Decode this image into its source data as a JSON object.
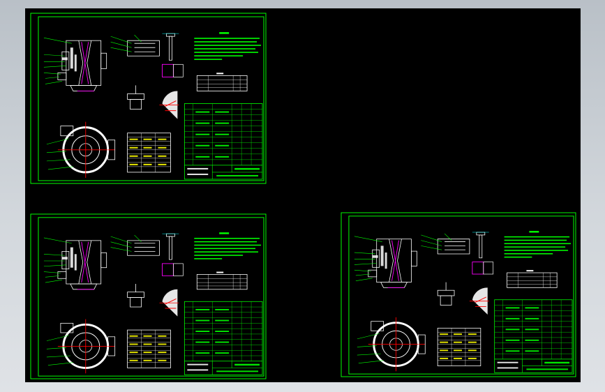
{
  "colors": {
    "background": "#c9cfd5",
    "viewport": "#000000",
    "sheet_frame": "#00ff00",
    "line": "#00ff00",
    "text": "#ffffff",
    "table_text": "#ffff00",
    "dimension": "#00ffff",
    "highlight": "#ff00ff",
    "part": "#ffffff"
  },
  "sheets": [
    {
      "id": "sheet-1",
      "style": "green"
    },
    {
      "id": "sheet-2",
      "style": "green"
    },
    {
      "id": "sheet-3",
      "style": "white"
    }
  ]
}
